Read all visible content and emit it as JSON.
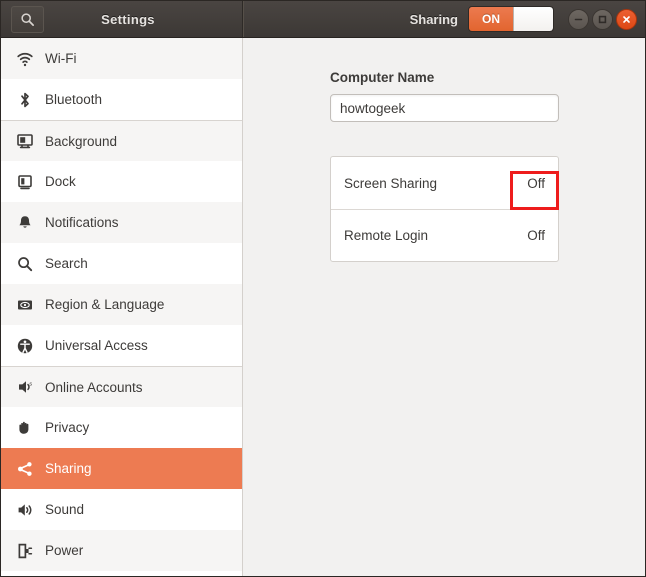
{
  "titlebar": {
    "search_icon": "search-icon",
    "app_title": "Settings",
    "page_title": "Sharing",
    "toggle": {
      "label": "ON",
      "state": "on",
      "accent_color": "#e2652f"
    },
    "window_controls": {
      "minimize": "minimize-icon",
      "maximize": "maximize-icon",
      "close": "close-icon"
    }
  },
  "sidebar": {
    "active_item": "Sharing",
    "active_color": "#ed7b52",
    "items": [
      {
        "label": "Wi-Fi",
        "icon": "wifi-icon",
        "shade": "shade",
        "separator": false
      },
      {
        "label": "Bluetooth",
        "icon": "bluetooth-icon",
        "shade": "plain",
        "separator": false
      },
      {
        "label": "Background",
        "icon": "background-icon",
        "shade": "shade",
        "separator": true
      },
      {
        "label": "Dock",
        "icon": "dock-icon",
        "shade": "plain",
        "separator": false
      },
      {
        "label": "Notifications",
        "icon": "notifications-icon",
        "shade": "shade",
        "separator": false
      },
      {
        "label": "Search",
        "icon": "search-icon",
        "shade": "plain",
        "separator": false
      },
      {
        "label": "Region & Language",
        "icon": "region-language-icon",
        "shade": "shade",
        "separator": false
      },
      {
        "label": "Universal Access",
        "icon": "universal-access-icon",
        "shade": "plain",
        "separator": false
      },
      {
        "label": "Online Accounts",
        "icon": "online-accounts-icon",
        "shade": "shade",
        "separator": true
      },
      {
        "label": "Privacy",
        "icon": "privacy-icon",
        "shade": "plain",
        "separator": false
      },
      {
        "label": "Sharing",
        "icon": "sharing-icon",
        "shade": "active",
        "separator": false
      },
      {
        "label": "Sound",
        "icon": "sound-icon",
        "shade": "plain",
        "separator": false
      },
      {
        "label": "Power",
        "icon": "power-icon",
        "shade": "shade",
        "separator": false
      }
    ]
  },
  "main": {
    "computer_name": {
      "label": "Computer Name",
      "value": "howtogeek",
      "placeholder": "Computer Name"
    },
    "options": [
      {
        "name": "Screen Sharing",
        "value": "Off",
        "highlighted": true
      },
      {
        "name": "Remote Login",
        "value": "Off",
        "highlighted": false
      }
    ]
  },
  "annotation": {
    "highlight_color": "#ee1c1c",
    "target": "Screen Sharing Off"
  }
}
